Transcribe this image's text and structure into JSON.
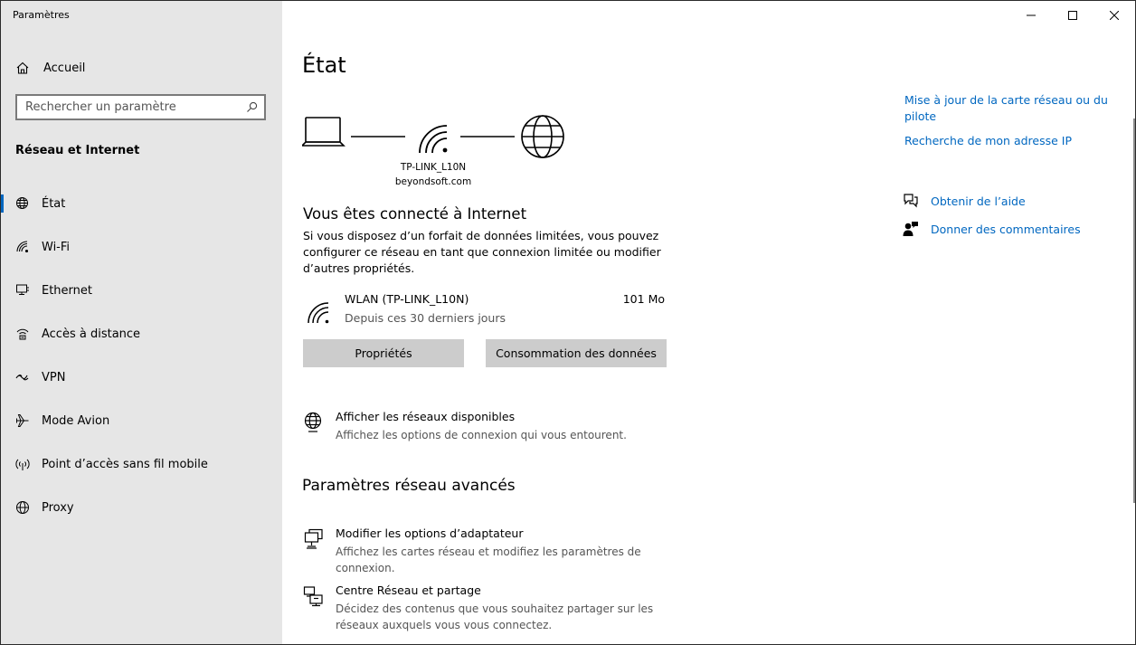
{
  "window": {
    "app_title": "Paramètres"
  },
  "sidebar": {
    "home_label": "Accueil",
    "search_placeholder": "Rechercher un paramètre",
    "section_title": "Réseau et Internet",
    "items": [
      {
        "label": "État",
        "icon": "globe-icon",
        "selected": true
      },
      {
        "label": "Wi-Fi",
        "icon": "wifi-icon"
      },
      {
        "label": "Ethernet",
        "icon": "ethernet-icon"
      },
      {
        "label": "Accès à distance",
        "icon": "dialup-icon"
      },
      {
        "label": "VPN",
        "icon": "vpn-icon"
      },
      {
        "label": "Mode Avion",
        "icon": "airplane-icon"
      },
      {
        "label": "Point d’accès sans fil mobile",
        "icon": "hotspot-icon"
      },
      {
        "label": "Proxy",
        "icon": "proxy-globe-icon"
      }
    ]
  },
  "main": {
    "title": "État",
    "network": {
      "ssid": "TP-LINK_L10N",
      "domain": "beyondsoft.com"
    },
    "status_heading": "Vous êtes connecté à Internet",
    "status_desc": "Si vous disposez d’un forfait de données limitées, vous pouvez configurer ce réseau en tant que connexion limitée ou modifier d’autres propriétés.",
    "connection": {
      "name": "WLAN (TP-LINK_L10N)",
      "period": "Depuis ces 30 derniers jours",
      "usage": "101 Mo"
    },
    "buttons": {
      "properties": "Propriétés",
      "data_usage": "Consommation des données"
    },
    "show_networks": {
      "title": "Afficher les réseaux disponibles",
      "desc": "Affichez les options de connexion qui vous entourent."
    },
    "advanced_heading": "Paramètres réseau avancés",
    "adapter": {
      "title": "Modifier les options d’adaptateur",
      "desc": "Affichez les cartes réseau et modifiez les paramètres de connexion."
    },
    "sharing": {
      "title": "Centre Réseau et partage",
      "desc": "Décidez des contenus que vous souhaitez partager sur les réseaux auxquels vous vous connectez."
    }
  },
  "right": {
    "link_update": "Mise à jour de la carte réseau ou du pilote",
    "link_ip": "Recherche de mon adresse IP",
    "help": "Obtenir de l’aide",
    "feedback": "Donner des commentaires"
  },
  "colors": {
    "accent": "#0067c0",
    "sidebar_bg": "#e6e6e6",
    "button_bg": "#cccccc"
  }
}
